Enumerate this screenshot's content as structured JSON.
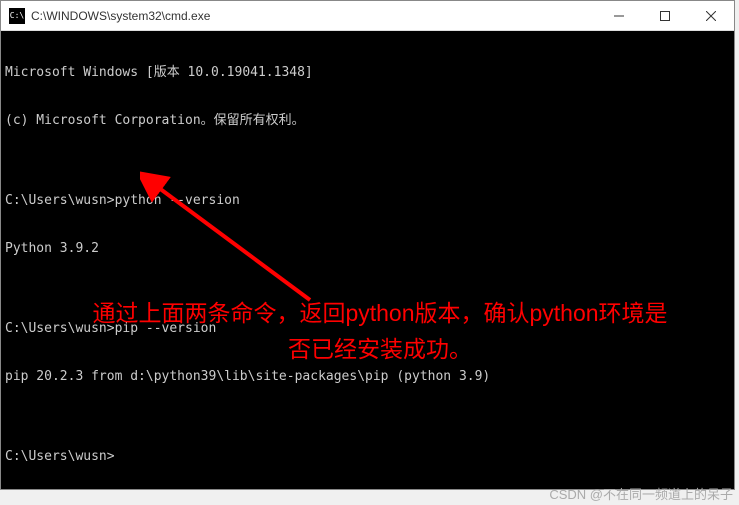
{
  "titlebar": {
    "icon_text": "C:\\",
    "title": "C:\\WINDOWS\\system32\\cmd.exe"
  },
  "terminal": {
    "line1": "Microsoft Windows [版本 10.0.19041.1348]",
    "line2": "(c) Microsoft Corporation。保留所有权利。",
    "line3": "",
    "line4": "C:\\Users\\wusn>python --version",
    "line5": "Python 3.9.2",
    "line6": "",
    "line7": "C:\\Users\\wusn>pip --version",
    "line8": "pip 20.2.3 from d:\\python39\\lib\\site-packages\\pip (python 3.9)",
    "line9": "",
    "line10": "C:\\Users\\wusn>"
  },
  "annotation": {
    "text": "通过上面两条命令，返回python版本，确认python环境是否已经安装成功。"
  },
  "watermark": "CSDN @不在同一频道上的呆子"
}
